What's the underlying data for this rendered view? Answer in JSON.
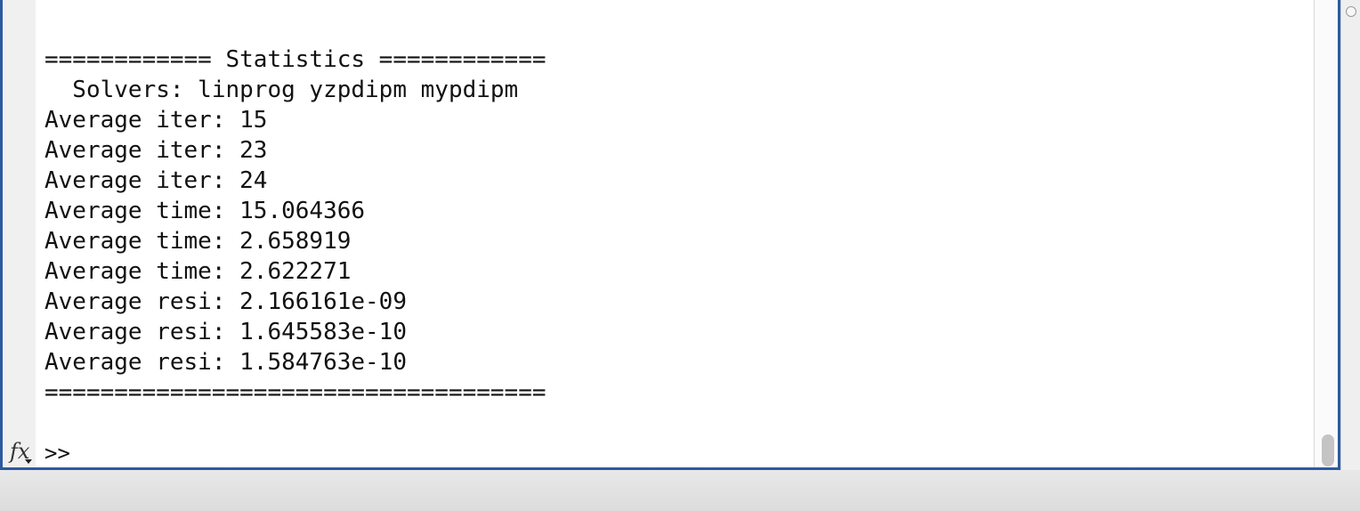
{
  "console": {
    "lines": [
      "============ Statistics ============",
      "  Solvers: linprog yzpdipm mypdipm",
      "Average iter: 15",
      "Average iter: 23",
      "Average iter: 24",
      "Average time: 15.064366",
      "Average time: 2.658919",
      "Average time: 2.622271",
      "Average resi: 2.166161e-09",
      "Average resi: 1.645583e-10",
      "Average resi: 1.584763e-10",
      "===================================="
    ],
    "fx_label": "fx",
    "prompt": ">>"
  },
  "colors": {
    "window_border": "#2d5aa0",
    "background": "#ffffff",
    "text": "#111111"
  }
}
